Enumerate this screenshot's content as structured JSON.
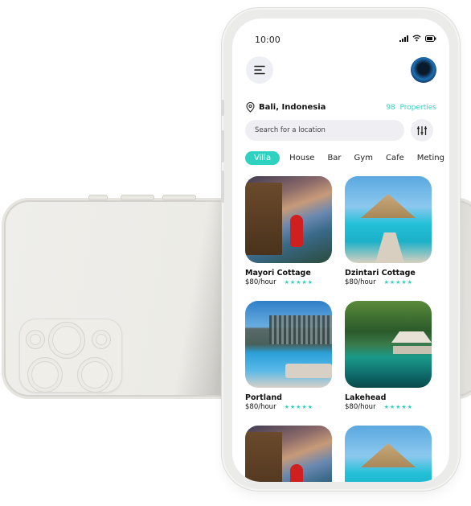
{
  "status_bar": {
    "time": "10:00"
  },
  "header": {
    "menu_icon": "hamburger-menu-icon",
    "avatar": "user-avatar"
  },
  "location": {
    "label": "Bali, Indonesia",
    "properties_count": "98",
    "properties_label": "Properties"
  },
  "search": {
    "placeholder": "Search for a location"
  },
  "categories": [
    {
      "label": "Villa",
      "active": true
    },
    {
      "label": "House",
      "active": false
    },
    {
      "label": "Bar",
      "active": false
    },
    {
      "label": "Gym",
      "active": false
    },
    {
      "label": "Cafe",
      "active": false
    },
    {
      "label": "Meting",
      "active": false
    }
  ],
  "listings": [
    {
      "name": "Mayori Cottage",
      "price": "$80/hour",
      "rating": 5,
      "stars": "★★★★★"
    },
    {
      "name": "Dzintari Cottage",
      "price": "$80/hour",
      "rating": 5,
      "stars": "★★★★★"
    },
    {
      "name": "Portland",
      "price": "$80/hour",
      "rating": 5,
      "stars": "★★★★★"
    },
    {
      "name": "Lakehead",
      "price": "$80/hour",
      "rating": 5,
      "stars": "★★★★★"
    }
  ],
  "colors": {
    "accent": "#2fd2c0",
    "chip_bg": "#eeeef3"
  }
}
